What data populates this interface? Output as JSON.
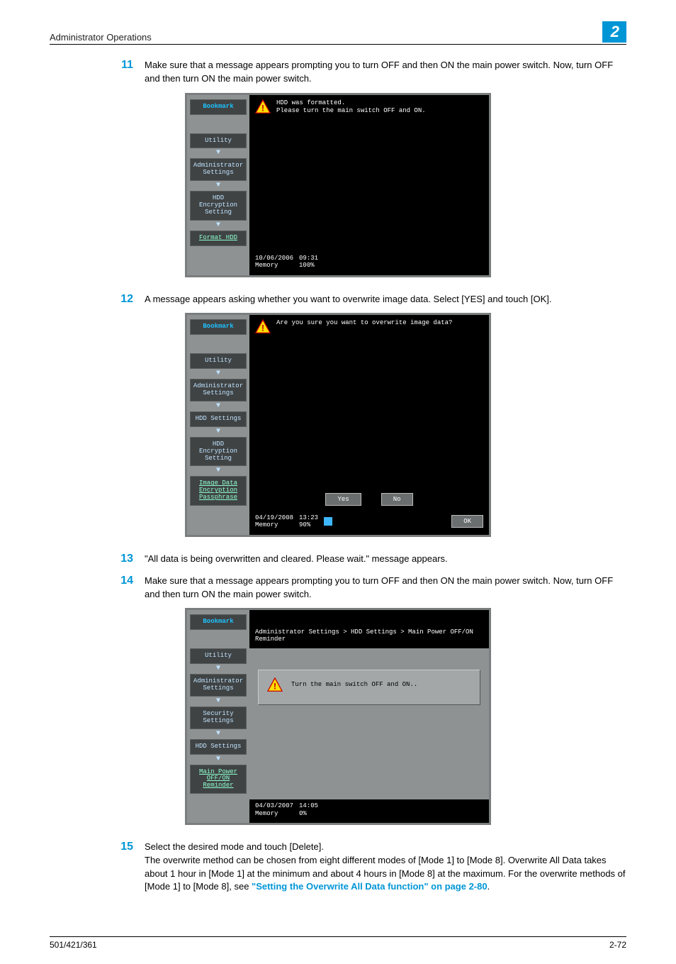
{
  "header": {
    "section": "Administrator Operations",
    "chapter": "2"
  },
  "steps": {
    "s11": {
      "num": "11",
      "text": "Make sure that a message appears prompting you to turn OFF and then ON the main power switch. Now, turn OFF and then turn ON the main power switch."
    },
    "s12": {
      "num": "12",
      "text": "A message appears asking whether you want to overwrite image data. Select [YES] and touch [OK]."
    },
    "s13": {
      "num": "13",
      "text": "\"All data is being overwritten and cleared. Please wait.\" message appears."
    },
    "s14": {
      "num": "14",
      "text": "Make sure that a message appears prompting you to turn OFF and then ON the main power switch. Now, turn OFF and then turn ON the main power switch."
    },
    "s15": {
      "num": "15",
      "line1": "Select the desired mode and touch [Delete].",
      "line2a": "The overwrite method can be chosen from eight different modes of [Mode 1] to [Mode 8]. Overwrite All Data takes about 1 hour in [Mode 1] at the minimum and about 4 hours in [Mode 8] at the maximum. For the overwrite methods of [Mode 1] to [Mode 8], see ",
      "link": "\"Setting the Overwrite All Data function\" on page 2-80",
      "line2b": "."
    }
  },
  "screen1": {
    "sidebar": {
      "bookmark": "Bookmark",
      "utility": "Utility",
      "admin": "Administrator Settings",
      "hdd_enc": "HDD Encryption Setting",
      "format": "Format HDD"
    },
    "msg1": "HDD was formatted.",
    "msg2": "Please turn the main switch OFF and ON.",
    "status": {
      "date": "10/06/2006",
      "time": "09:31",
      "mem_label": "Memory",
      "mem_val": "100%"
    }
  },
  "screen2": {
    "sidebar": {
      "bookmark": "Bookmark",
      "utility": "Utility",
      "admin": "Administrator Settings",
      "hdd_set": "HDD Settings",
      "hdd_enc": "HDD Encryption Setting",
      "passphrase": "Image Data Encryption Passphrase"
    },
    "question": "Are you sure you want to overwrite image data?",
    "yes": "Yes",
    "no": "No",
    "ok": "OK",
    "status": {
      "date": "04/19/2008",
      "time": "13:23",
      "mem_label": "Memory",
      "mem_val": "90%"
    }
  },
  "screen3": {
    "sidebar": {
      "bookmark": "Bookmark",
      "utility": "Utility",
      "admin": "Administrator Settings",
      "security": "Security Settings",
      "hdd_set": "HDD Settings",
      "reminder": "Main Power OFF/ON Reminder"
    },
    "breadcrumb": "Administrator Settings > HDD Settings > Main Power OFF/ON Reminder",
    "msg": "Turn the main switch OFF and ON..",
    "status": {
      "date": "04/03/2007",
      "time": "14:05",
      "mem_label": "Memory",
      "mem_val": "0%"
    }
  },
  "footer": {
    "model": "501/421/361",
    "page": "2-72"
  }
}
